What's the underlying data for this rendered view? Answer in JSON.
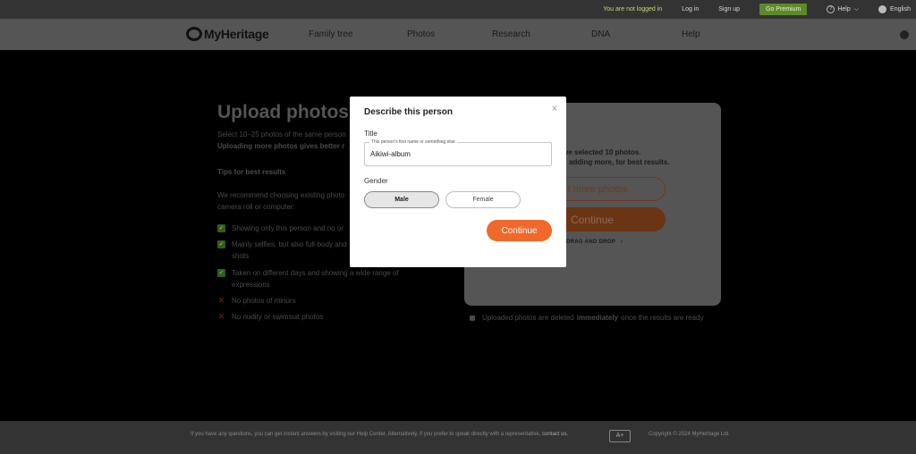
{
  "topbar": {
    "status": "You are not logged in",
    "login": "Log in",
    "signup": "Sign up",
    "premium": "Go Premium",
    "help": "Help",
    "help_chevron": "⌵",
    "help_icon": "?",
    "language": "English"
  },
  "nav": {
    "brand": "MyHeritage",
    "items": [
      "Family tree",
      "Photos",
      "Research",
      "DNA",
      "Help"
    ]
  },
  "page": {
    "title": "Upload photos",
    "intro_line1": "Select 10–25 photos of the same person",
    "intro_line2": "Uploading more photos gives better r",
    "tips_heading": "Tips for best results",
    "tips_text": "We recommend choosing existing photo camera roll or computer:",
    "tips": [
      {
        "mark": "✓",
        "text": "Showing only this person and no or"
      },
      {
        "mark": "✓",
        "text": "Mainly selfies, but also full-body and shots"
      },
      {
        "mark": "✓",
        "text": "Taken on different days and showing a wide range of expressions"
      },
      {
        "mark": "✕",
        "text": "No photos of minors"
      },
      {
        "mark": "✕",
        "text": "No nudity or swimsuit photos"
      }
    ]
  },
  "upload_card": {
    "line1": "ve selected 10 photos.",
    "line2": "adding more, for best results.",
    "select_more": "ect more photos",
    "continue": "Continue",
    "drag_drop": "DRAG AND DROP",
    "drag_chevron": "›",
    "note_before": "Uploaded photos are deleted",
    "note_bold": "immediately",
    "note_after": "once the results are ready"
  },
  "modal": {
    "title": "Describe this person",
    "close": "×",
    "title_label": "Title",
    "input_float_label": "This person's first name or something else",
    "input_value": "Aikiwi-album",
    "gender_label": "Gender",
    "gender_male": "Male",
    "gender_female": "Female",
    "continue": "Continue"
  },
  "footer": {
    "help_text": "If you have any questions, you can get instant answers by visiting our Help Center. Alternatively, if you prefer to speak directly with a representative,",
    "contact": "contact us.",
    "access": "A+",
    "copyright": "Copyright © 2024 MyHeritage Ltd."
  },
  "colors": {
    "accent": "#f0692a",
    "premium": "#5c8a2a"
  }
}
